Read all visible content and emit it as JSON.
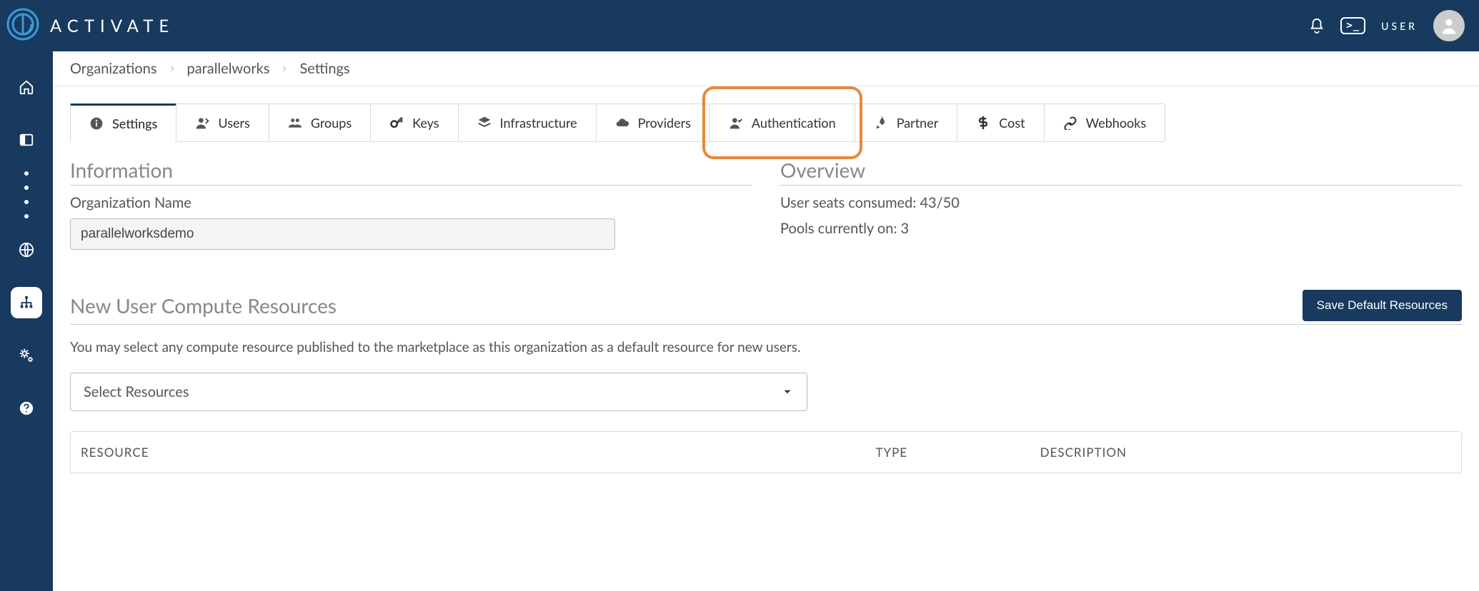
{
  "brand": {
    "name": "ACTIVATE"
  },
  "header": {
    "user_label": "USER"
  },
  "breadcrumb": [
    "Organizations",
    "parallelworks",
    "Settings"
  ],
  "tabs": [
    {
      "id": "settings",
      "label": "Settings",
      "icon": "info"
    },
    {
      "id": "users",
      "label": "Users",
      "icon": "user"
    },
    {
      "id": "groups",
      "label": "Groups",
      "icon": "group"
    },
    {
      "id": "keys",
      "label": "Keys",
      "icon": "key"
    },
    {
      "id": "infrastructure",
      "label": "Infrastructure",
      "icon": "layers"
    },
    {
      "id": "providers",
      "label": "Providers",
      "icon": "cloud"
    },
    {
      "id": "authentication",
      "label": "Authentication",
      "icon": "user-check"
    },
    {
      "id": "partner",
      "label": "Partner",
      "icon": "rocket"
    },
    {
      "id": "cost",
      "label": "Cost",
      "icon": "dollar"
    },
    {
      "id": "webhooks",
      "label": "Webhooks",
      "icon": "link"
    }
  ],
  "active_tab_index": 0,
  "highlighted_tab_index": 6,
  "information": {
    "title": "Information",
    "org_name_label": "Organization Name",
    "org_name_value": "parallelworksdemo"
  },
  "overview": {
    "title": "Overview",
    "seats_label": "User seats consumed:",
    "seats_value": "43/50",
    "pools_label": "Pools currently on:",
    "pools_value": "3"
  },
  "resources": {
    "title": "New User Compute Resources",
    "save_button": "Save Default Resources",
    "help": "You may select any compute resource published to the marketplace as this organization as a default resource for new users.",
    "select_placeholder": "Select Resources",
    "columns": {
      "resource": "RESOURCE",
      "type": "TYPE",
      "description": "DESCRIPTION"
    }
  }
}
